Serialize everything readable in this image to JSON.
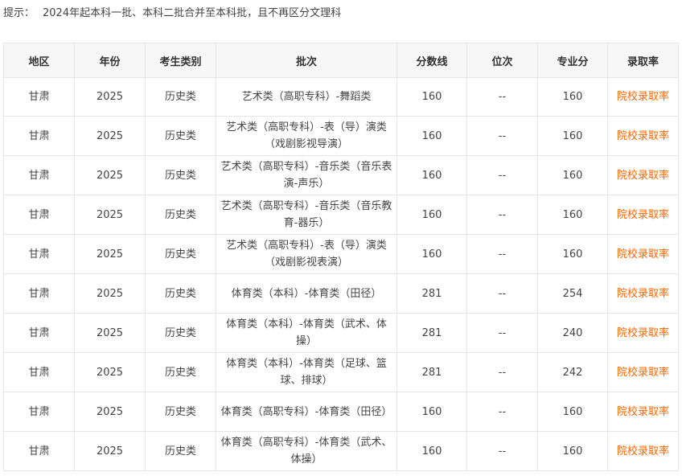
{
  "tip": {
    "label": "提示：",
    "text": "2024年起本科一批、本科二批合并至本科批，且不再区分文理科"
  },
  "colors": {
    "header_bg": "#f7f7f7",
    "border": "#e6e6e6",
    "link": "#ff6600"
  },
  "table": {
    "headers": [
      "地区",
      "年份",
      "考生类别",
      "批次",
      "分数线",
      "位次",
      "专业分",
      "录取率"
    ],
    "rows": [
      {
        "region": "甘肃",
        "year": "2025",
        "category": "历史类",
        "batch": "艺术类（高职专科）-舞蹈类",
        "score": "160",
        "rank": "--",
        "major_score": "160",
        "rate": "院校录取率"
      },
      {
        "region": "甘肃",
        "year": "2025",
        "category": "历史类",
        "batch": "艺术类（高职专科）-表（导）演类（戏剧影视导演）",
        "score": "160",
        "rank": "--",
        "major_score": "160",
        "rate": "院校录取率"
      },
      {
        "region": "甘肃",
        "year": "2025",
        "category": "历史类",
        "batch": "艺术类（高职专科）-音乐类（音乐表演-声乐）",
        "score": "160",
        "rank": "--",
        "major_score": "160",
        "rate": "院校录取率"
      },
      {
        "region": "甘肃",
        "year": "2025",
        "category": "历史类",
        "batch": "艺术类（高职专科）-音乐类（音乐教育-器乐）",
        "score": "160",
        "rank": "--",
        "major_score": "160",
        "rate": "院校录取率"
      },
      {
        "region": "甘肃",
        "year": "2025",
        "category": "历史类",
        "batch": "艺术类（高职专科）-表（导）演类（戏剧影视表演）",
        "score": "160",
        "rank": "--",
        "major_score": "160",
        "rate": "院校录取率"
      },
      {
        "region": "甘肃",
        "year": "2025",
        "category": "历史类",
        "batch": "体育类（本科）-体育类（田径）",
        "score": "281",
        "rank": "--",
        "major_score": "254",
        "rate": "院校录取率"
      },
      {
        "region": "甘肃",
        "year": "2025",
        "category": "历史类",
        "batch": "体育类（本科）-体育类（武术、体操）",
        "score": "281",
        "rank": "--",
        "major_score": "240",
        "rate": "院校录取率"
      },
      {
        "region": "甘肃",
        "year": "2025",
        "category": "历史类",
        "batch": "体育类（本科）-体育类（足球、篮球、排球）",
        "score": "281",
        "rank": "--",
        "major_score": "242",
        "rate": "院校录取率"
      },
      {
        "region": "甘肃",
        "year": "2025",
        "category": "历史类",
        "batch": "体育类（高职专科）-体育类（田径）",
        "score": "160",
        "rank": "--",
        "major_score": "160",
        "rate": "院校录取率"
      },
      {
        "region": "甘肃",
        "year": "2025",
        "category": "历史类",
        "batch": "体育类（高职专科）-体育类（武术、体操）",
        "score": "160",
        "rank": "--",
        "major_score": "160",
        "rate": "院校录取率"
      }
    ]
  }
}
